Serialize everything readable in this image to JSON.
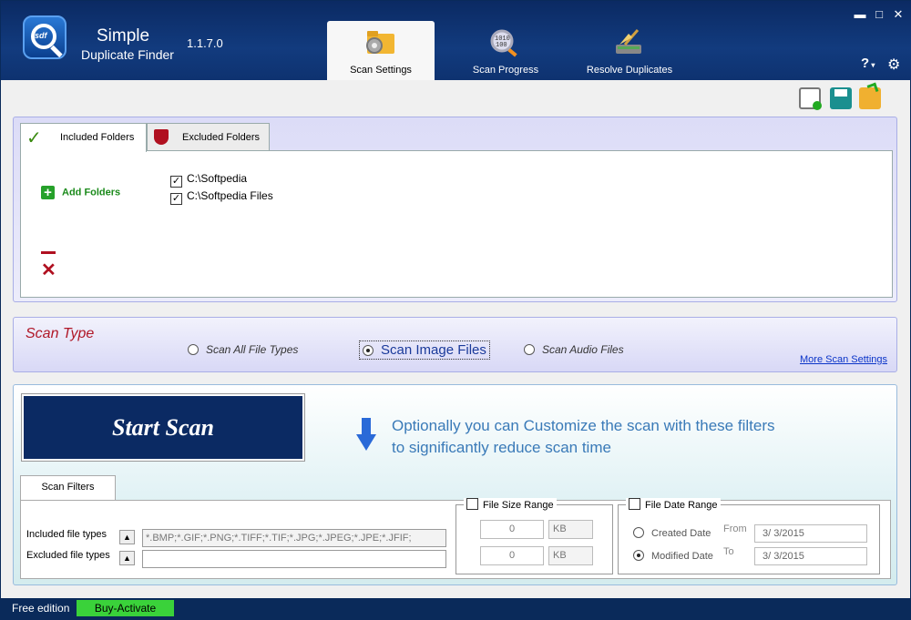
{
  "app": {
    "name_line1": "Simple",
    "name_line2": "Duplicate Finder",
    "version": "1.1.7.0",
    "logo_text": "sdf"
  },
  "tabs": [
    {
      "label": "Scan Settings",
      "active": true
    },
    {
      "label": "Scan Progress",
      "active": false
    },
    {
      "label": "Resolve Duplicates",
      "active": false
    }
  ],
  "window_controls": {
    "minimize": "▬",
    "maximize": "□",
    "close": "✕",
    "help": "?",
    "settings": "⚙"
  },
  "folders": {
    "tab_included": "Included Folders",
    "tab_excluded": "Excluded Folders",
    "add_label": "Add Folders",
    "items": [
      {
        "path": "C:\\Softpedia",
        "checked": true
      },
      {
        "path": "C:\\Softpedia Files",
        "checked": true
      }
    ]
  },
  "scan_type": {
    "title": "Scan Type",
    "options": [
      {
        "label": "Scan All File Types",
        "selected": false
      },
      {
        "label": "Scan Image Files",
        "selected": true
      },
      {
        "label": "Scan Audio Files",
        "selected": false
      }
    ],
    "more_link": "More Scan Settings"
  },
  "main": {
    "start_button": "Start Scan",
    "hint": "Optionally you can Customize the scan with these filters to significantly reduce scan time",
    "filters_tab": "Scan Filters",
    "included_label": "Included file types",
    "excluded_label": "Excluded file types",
    "included_value": "*.BMP;*.GIF;*.PNG;*.TIFF;*.TIF;*.JPG;*.JPEG;*.JPE;*.JFIF;",
    "excluded_value": "",
    "size_range_label": "File Size Range",
    "size_min": "0",
    "size_max": "0",
    "size_unit_min": "KB",
    "size_unit_max": "KB",
    "date_range_label": "File Date Range",
    "created_label": "Created Date",
    "modified_label": "Modified Date",
    "from_label": "From",
    "to_label": "To",
    "date_from": "3/  3/2015",
    "date_to": "3/  3/2015"
  },
  "status": {
    "edition": "Free edition",
    "buy_label": "Buy-Activate"
  },
  "colors": {
    "brand": "#0b2a63",
    "accent_green": "#3ad23a",
    "title_red": "#b01828",
    "hint_blue": "#3a7ab8"
  }
}
